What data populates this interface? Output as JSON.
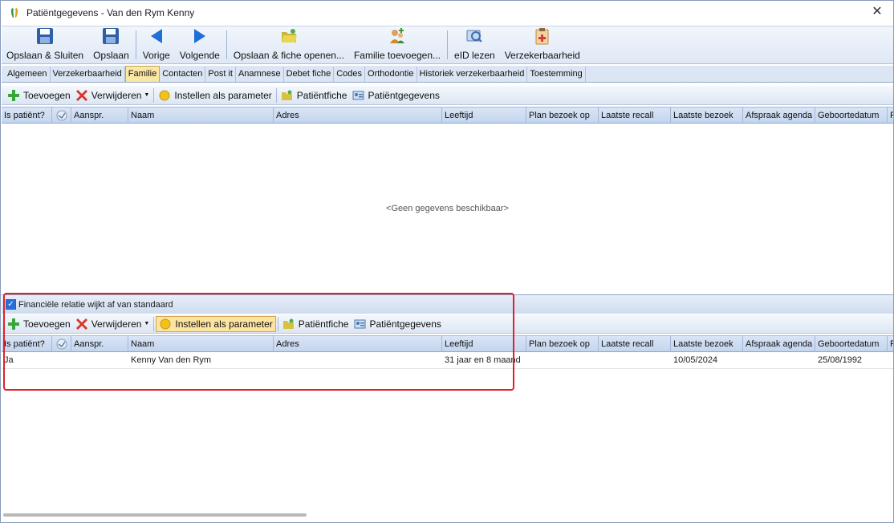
{
  "window": {
    "title": "Patiëntgegevens - Van den Rym Kenny",
    "close_label": "✕"
  },
  "ribbon": {
    "buttons": [
      {
        "label": "Opslaan & Sluiten",
        "icon": "save-icon"
      },
      {
        "label": "Opslaan",
        "icon": "save-icon"
      },
      {
        "label": "Vorige",
        "icon": "arrow-left-icon"
      },
      {
        "label": "Volgende",
        "icon": "arrow-right-icon"
      },
      {
        "label": "Opslaan & fiche openen...",
        "icon": "folder-open-icon"
      },
      {
        "label": "Familie toevoegen...",
        "icon": "family-add-icon"
      },
      {
        "label": "eID lezen",
        "icon": "id-card-icon"
      },
      {
        "label": "Verzekerbaarheid",
        "icon": "clipboard-medical-icon"
      }
    ]
  },
  "tabs": [
    {
      "label": "Algemeen",
      "active": false
    },
    {
      "label": "Verzekerbaarheid",
      "active": false
    },
    {
      "label": "Familie",
      "active": true
    },
    {
      "label": "Contacten",
      "active": false
    },
    {
      "label": "Post it",
      "active": false
    },
    {
      "label": "Anamnese",
      "active": false
    },
    {
      "label": "Debet fiche",
      "active": false
    },
    {
      "label": "Codes",
      "active": false
    },
    {
      "label": "Orthodontie",
      "active": false
    },
    {
      "label": "Historiek verzekerbaarheid",
      "active": false
    },
    {
      "label": "Toestemming",
      "active": false
    }
  ],
  "toolbar_top": {
    "add": "Toevoegen",
    "remove": "Verwijderen",
    "set_param": "Instellen als parameter",
    "patient_card": "Patiëntfiche",
    "patient_data": "Patiëntgegevens"
  },
  "toolbar_bottom": {
    "add": "Toevoegen",
    "remove": "Verwijderen",
    "set_param": "Instellen als parameter",
    "patient_card": "Patiëntfiche",
    "patient_data": "Patiëntgegevens"
  },
  "grid_columns": [
    "Is patiënt?",
    "",
    "Aanspr.",
    "Naam",
    "Adres",
    "Leeftijd",
    "Plan bezoek op",
    "Laatste recall",
    "Laatste bezoek",
    "Afspraak agenda",
    "Geboortedatum",
    "F"
  ],
  "top_grid": {
    "empty_message": "<Geen gegevens beschikbaar>"
  },
  "financial": {
    "checkbox_label": "Financiële relatie wijkt af van standaard",
    "checked": true
  },
  "bottom_grid": {
    "rows": [
      {
        "is_patient": "Ja",
        "aanspr": "",
        "naam": "Kenny Van den Rym",
        "adres": "",
        "leeftijd": "31 jaar en 8 maand",
        "plan_bezoek": "",
        "laatste_recall": "",
        "laatste_bezoek": "10/05/2024",
        "afspraak": "",
        "geboortedatum": "25/08/1992"
      }
    ]
  },
  "colors": {
    "accent": "#2b6fd6",
    "highlight_box": "#e0202a",
    "active_tab": "#fbe7a5"
  }
}
